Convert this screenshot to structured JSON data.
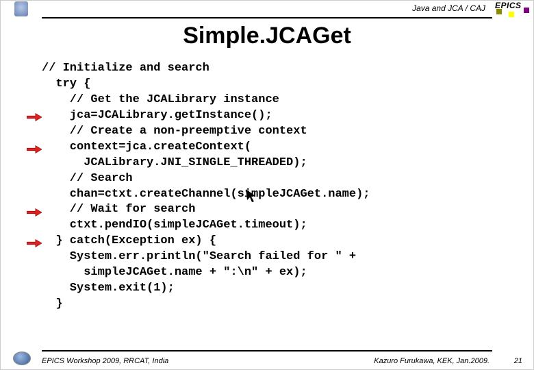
{
  "header": {
    "topic": "Java and JCA / CAJ",
    "brand": "EPICS"
  },
  "title": "Simple.JCAGet",
  "code": {
    "l0": "// Initialize and search",
    "l1": "  try {",
    "l2": "    // Get the JCALibrary instance",
    "l3": "    jca=JCALibrary.getInstance();",
    "l4": "    // Create a non-preemptive context",
    "l5": "    context=jca.createContext(",
    "l6": "      JCALibrary.JNI_SINGLE_THREADED);",
    "l7": "    // Search",
    "l8": "    chan=ctxt.createChannel(simpleJCAGet.name);",
    "l9": "    // Wait for search",
    "l10": "    ctxt.pendIO(simpleJCAGet.timeout);",
    "l11": "  } catch(Exception ex) {",
    "l12": "    System.err.println(\"Search failed for \" +",
    "l13": "      simpleJCAGet.name + \":\\n\" + ex);",
    "l14": "    System.exit(1);",
    "l15": "  }"
  },
  "footer": {
    "left": "EPICS Workshop 2009, RRCAT, India",
    "right": "Kazuro Furukawa, KEK, Jan.2009.",
    "page": "21"
  }
}
